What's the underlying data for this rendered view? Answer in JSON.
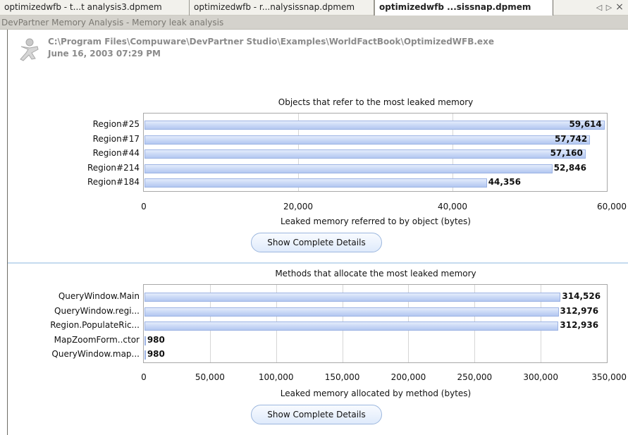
{
  "tabs": [
    {
      "label": "optimizedwfb - t...t analysis3.dpmem"
    },
    {
      "label": "optimizedwfb - r...nalysissnap.dpmem"
    },
    {
      "label": "optimizedwfb ...sissnap.dpmem"
    }
  ],
  "tab_controls": {
    "prev": "◁",
    "next": "▷",
    "close": "×"
  },
  "title": "DevPartner Memory Analysis - Memory leak analysis",
  "header": {
    "path": "C:\\Program Files\\Compuware\\DevPartner Studio\\Examples\\WorldFactBook\\OptimizedWFB.exe",
    "date": "June 16, 2003 07:29 PM",
    "icon": "leak-person-icon"
  },
  "colors": {
    "bar_fill": "#c8d7f6",
    "bar_border": "#9cb3e4",
    "divider": "#c5dbef"
  },
  "button_label": "Show Complete Details",
  "chart_data": [
    {
      "type": "bar",
      "orientation": "horizontal",
      "title": "Objects that refer to the most leaked memory",
      "xlabel": "Leaked memory referred to by object (bytes)",
      "categories": [
        "Region#25",
        "Region#17",
        "Region#44",
        "Region#214",
        "Region#184"
      ],
      "values": [
        59614,
        57742,
        57160,
        52846,
        44356
      ],
      "value_labels": [
        "59,614",
        "57,742",
        "57,160",
        "52,846",
        "44,356"
      ],
      "xlim": [
        0,
        60000
      ],
      "ticks": [
        0,
        20000,
        40000,
        60000
      ],
      "tick_labels": [
        "0",
        "20,000",
        "40,000",
        "60,000"
      ],
      "grid": true
    },
    {
      "type": "bar",
      "orientation": "horizontal",
      "title": "Methods that allocate the most leaked memory",
      "xlabel": "Leaked memory allocated by method (bytes)",
      "categories": [
        "QueryWindow.Main",
        "QueryWindow.regi...",
        "Region.PopulateRic...",
        "MapZoomForm..ctor",
        "QueryWindow.map..."
      ],
      "values": [
        314526,
        312976,
        312936,
        980,
        980
      ],
      "value_labels": [
        "314,526",
        "312,976",
        "312,936",
        "980",
        "980"
      ],
      "xlim": [
        0,
        350000
      ],
      "ticks": [
        0,
        50000,
        100000,
        150000,
        200000,
        250000,
        300000,
        350000
      ],
      "tick_labels": [
        "0",
        "50,000",
        "100,000",
        "150,000",
        "200,000",
        "250,000",
        "300,000",
        "350,000"
      ],
      "grid": true
    }
  ]
}
